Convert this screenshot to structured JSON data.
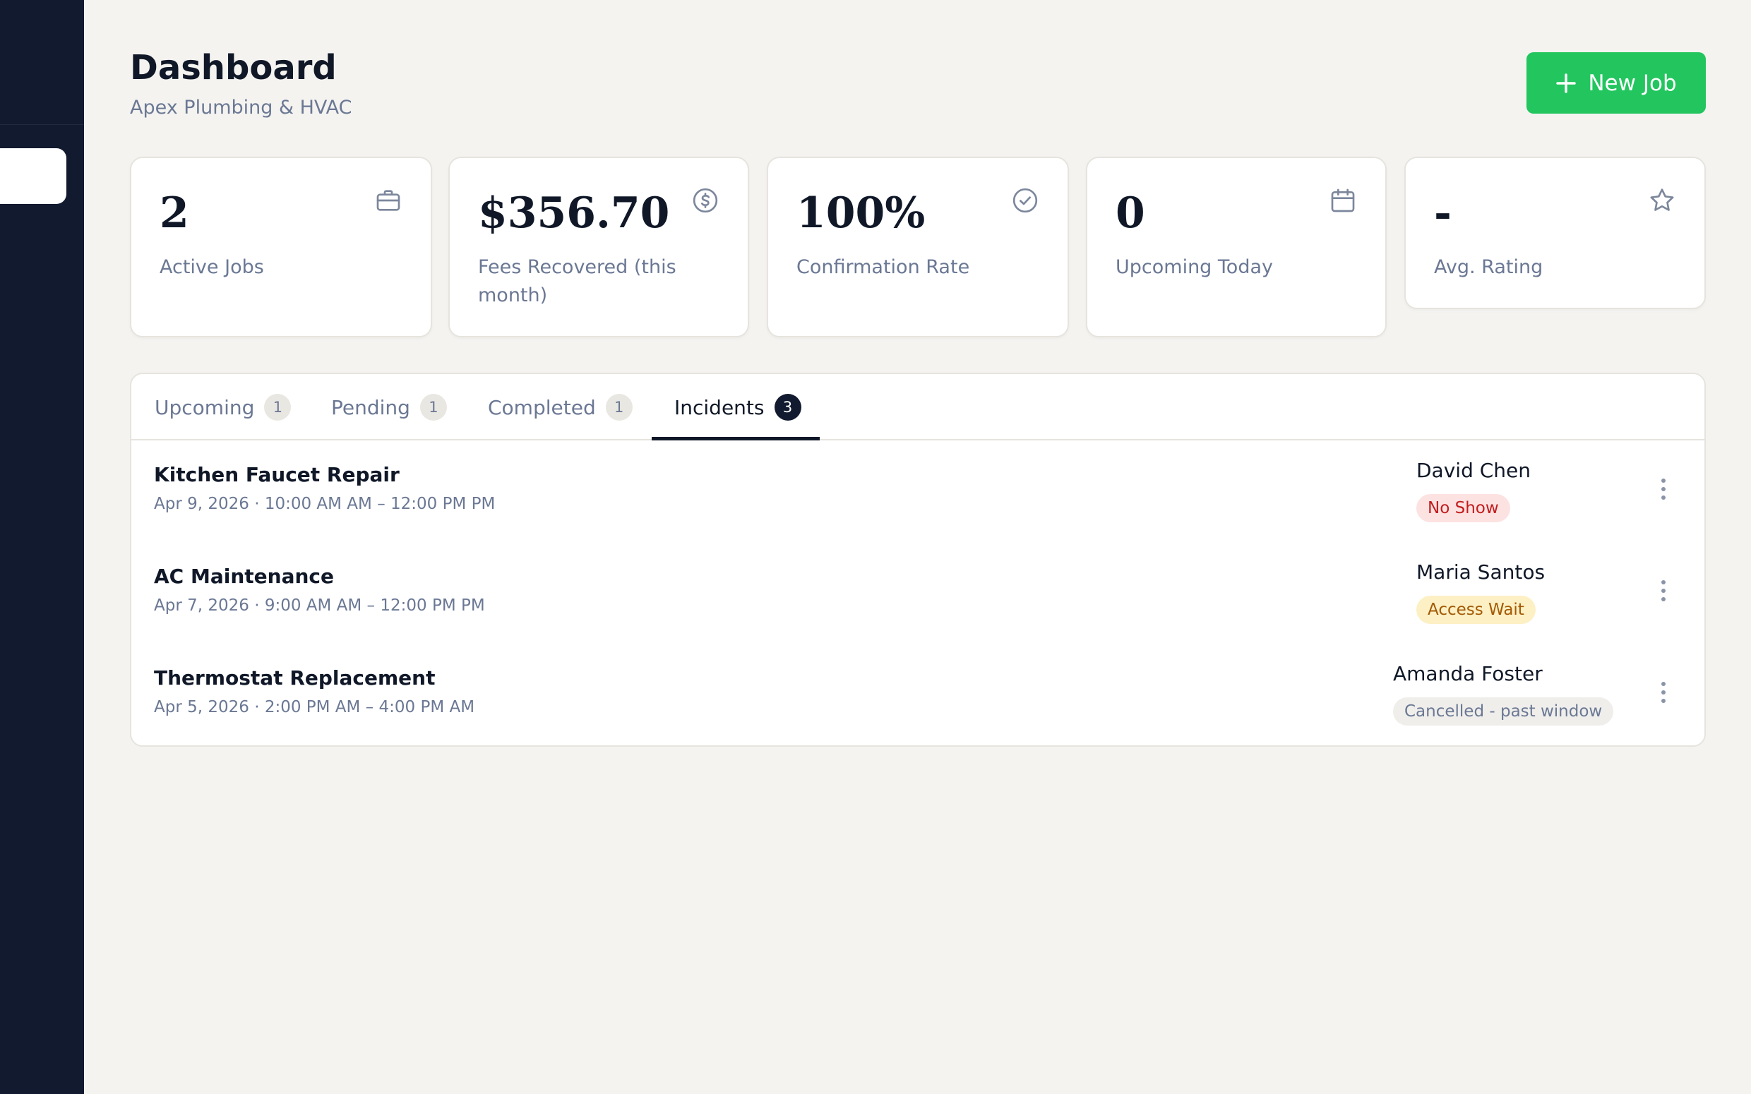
{
  "header": {
    "title": "Dashboard",
    "subtitle": "Apex Plumbing & HVAC",
    "new_job_label": "New Job"
  },
  "stats": [
    {
      "value": "2",
      "label": "Active Jobs",
      "icon": "briefcase-icon"
    },
    {
      "value": "$356.70",
      "label": "Fees Recovered (this month)",
      "icon": "dollar-circle-icon"
    },
    {
      "value": "100%",
      "label": "Confirmation Rate",
      "icon": "check-circle-icon"
    },
    {
      "value": "0",
      "label": "Upcoming Today",
      "icon": "calendar-icon"
    },
    {
      "value": "-",
      "label": "Avg. Rating",
      "icon": "star-icon"
    }
  ],
  "tabs": [
    {
      "label": "Upcoming",
      "count": "1",
      "active": false
    },
    {
      "label": "Pending",
      "count": "1",
      "active": false
    },
    {
      "label": "Completed",
      "count": "1",
      "active": false
    },
    {
      "label": "Incidents",
      "count": "3",
      "active": true
    }
  ],
  "incidents": [
    {
      "title": "Kitchen Faucet Repair",
      "schedule": "Apr 9, 2026 · 10:00 AM AM – 12:00 PM PM",
      "customer": "David Chen",
      "status": "No Show",
      "status_color": "#c21d1d"
    },
    {
      "title": "AC Maintenance",
      "schedule": "Apr 7, 2026 · 9:00 AM AM – 12:00 PM PM",
      "customer": "Maria Santos",
      "status": "Access Wait",
      "status_color": "#a35a06"
    },
    {
      "title": "Thermostat Replacement",
      "schedule": "Apr 5, 2026 · 2:00 PM AM – 4:00 PM AM",
      "customer": "Amanda Foster",
      "status": "Cancelled - past window",
      "status_color": "#6b7894"
    }
  ],
  "colors": {
    "sidebar": "#111a2e",
    "accent": "#22c55e",
    "background": "#f4f3f0"
  }
}
